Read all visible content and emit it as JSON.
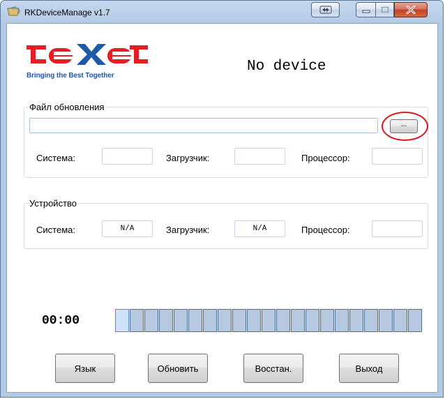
{
  "window": {
    "title": "RKDeviceManage v1.7"
  },
  "header": {
    "logo_text": "texet",
    "logo_slogan": "Bringing the Best Together",
    "device_status": "No device"
  },
  "update_file": {
    "legend": "Файл обновления",
    "path_value": "",
    "browse_label": "...",
    "system_label": "Система:",
    "system_value": "",
    "loader_label": "Загрузчик:",
    "loader_value": "",
    "cpu_label": "Процессор:",
    "cpu_value": ""
  },
  "device": {
    "legend": "Устройство",
    "system_label": "Система:",
    "system_value": "N/A",
    "loader_label": "Загрузчик:",
    "loader_value": "N/A",
    "cpu_label": "Процессор:",
    "cpu_value": ""
  },
  "progress": {
    "timer": "00:00",
    "segments_total": 21,
    "segments_active": 1
  },
  "buttons": {
    "language": "Язык",
    "update": "Обновить",
    "restore": "Восстан.",
    "exit": "Выход"
  },
  "colors": {
    "logo_red": "#e31e24",
    "logo_blue": "#1d5aa7",
    "highlight": "#e0131e",
    "progress_segment": "#b7c9e0"
  }
}
